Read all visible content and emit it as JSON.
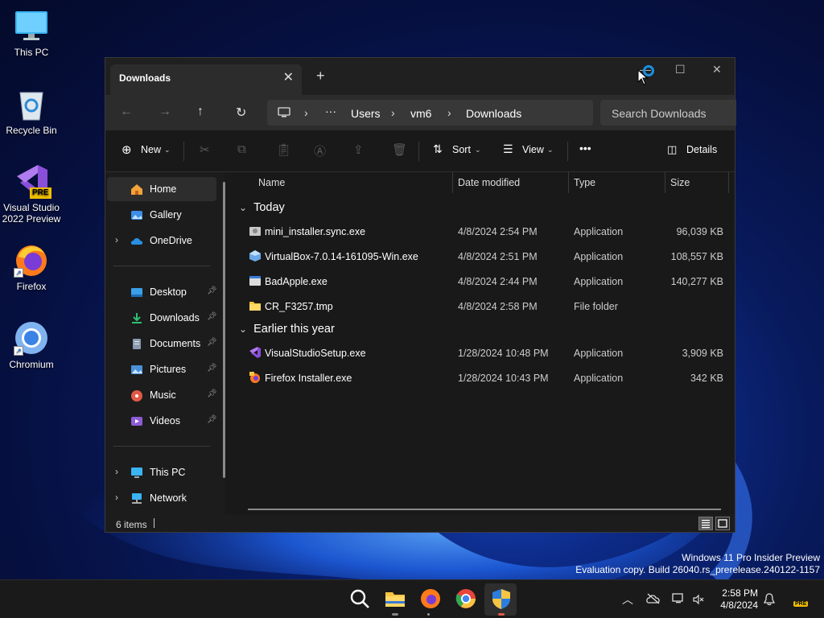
{
  "desktop": {
    "icons": [
      {
        "label": "This PC",
        "icon": "monitor-icon"
      },
      {
        "label": "Recycle Bin",
        "icon": "recycle-bin-icon"
      },
      {
        "label": "Visual Studio 2022 Preview",
        "icon": "visual-studio-icon",
        "badge": "PRE"
      },
      {
        "label": "Firefox",
        "icon": "firefox-icon"
      },
      {
        "label": "Chromium",
        "icon": "chromium-icon"
      }
    ]
  },
  "window": {
    "tab_title": "Downloads",
    "tab_close": "✕",
    "tab_new": "+",
    "controls": {
      "minimize": "—",
      "maximize": "☐",
      "close": "✕"
    },
    "address": {
      "ellipsis": "···",
      "crumbs": [
        "Users",
        "vm6",
        "Downloads"
      ]
    },
    "search_placeholder": "Search Downloads",
    "commands": {
      "new": "New",
      "sort": "Sort",
      "view": "View",
      "more": "•••",
      "details": "Details"
    },
    "nav": {
      "top": [
        {
          "label": "Home",
          "icon": "home-icon",
          "selected": true
        },
        {
          "label": "Gallery",
          "icon": "gallery-icon"
        },
        {
          "label": "OneDrive",
          "icon": "cloud-icon",
          "expandable": true
        }
      ],
      "pinned": [
        {
          "label": "Desktop",
          "icon": "desktop-folder-icon",
          "color": "#3aa0e8"
        },
        {
          "label": "Downloads",
          "icon": "download-icon",
          "color": "#2fbf71"
        },
        {
          "label": "Documents",
          "icon": "documents-icon",
          "color": "#8a9bb0"
        },
        {
          "label": "Pictures",
          "icon": "pictures-icon",
          "color": "#4a90d9"
        },
        {
          "label": "Music",
          "icon": "music-icon",
          "color": "#e05a47"
        },
        {
          "label": "Videos",
          "icon": "videos-icon",
          "color": "#8e5bd6"
        }
      ],
      "bottom": [
        {
          "label": "This PC",
          "icon": "monitor-icon"
        },
        {
          "label": "Network",
          "icon": "network-icon"
        }
      ]
    },
    "columns": {
      "name": "Name",
      "date": "Date modified",
      "type": "Type",
      "size": "Size"
    },
    "groups": [
      {
        "label": "Today",
        "files": [
          {
            "name": "mini_installer.sync.exe",
            "date": "4/8/2024 2:54 PM",
            "type": "Application",
            "size": "96,039 KB",
            "icon": "installer-icon"
          },
          {
            "name": "VirtualBox-7.0.14-161095-Win.exe",
            "date": "4/8/2024 2:51 PM",
            "type": "Application",
            "size": "108,557 KB",
            "icon": "virtualbox-icon"
          },
          {
            "name": "BadApple.exe",
            "date": "4/8/2024 2:44 PM",
            "type": "Application",
            "size": "140,277 KB",
            "icon": "exe-window-icon"
          },
          {
            "name": "CR_F3257.tmp",
            "date": "4/8/2024 2:58 PM",
            "type": "File folder",
            "size": "",
            "icon": "folder-icon"
          }
        ]
      },
      {
        "label": "Earlier this year",
        "files": [
          {
            "name": "VisualStudioSetup.exe",
            "date": "1/28/2024 10:48 PM",
            "type": "Application",
            "size": "3,909 KB",
            "icon": "visual-studio-icon"
          },
          {
            "name": "Firefox Installer.exe",
            "date": "1/28/2024 10:43 PM",
            "type": "Application",
            "size": "342 KB",
            "icon": "firefox-installer-icon"
          }
        ]
      }
    ],
    "status": "6 items"
  },
  "watermark": {
    "line1": "Windows 11 Pro Insider Preview",
    "line2": "Evaluation copy. Build 26040.rs_prerelease.240122-1157"
  },
  "taskbar": {
    "time": "2:58 PM",
    "date": "4/8/2024",
    "tray_badge": "PRE"
  }
}
